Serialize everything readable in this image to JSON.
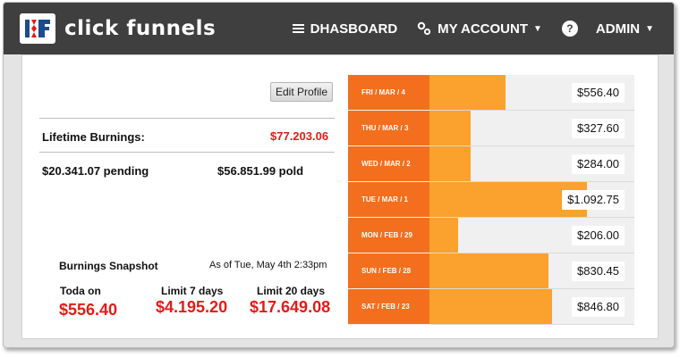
{
  "header": {
    "logo_text": "click funnels",
    "nav": {
      "dashboard": "DHASBOARD",
      "my_account": "MY ACCOUNT",
      "help": "?",
      "admin": "ADMIN"
    },
    "icons": [
      "menu-icon",
      "gear-icon",
      "help-icon",
      "caret-down-icon"
    ]
  },
  "profile": {
    "edit_label": "Edit Profile",
    "lifetime_label": "Lifetime Burnings:",
    "lifetime_value": "$77.203.06",
    "pending": "$20.341.07 pending",
    "paid": "$56.851.99 pold"
  },
  "snapshot": {
    "title": "Burnings Snapshot",
    "as_of": "As of Tue, May 4th 2:33pm",
    "today_label": "Toda on",
    "today_value": "$556.40",
    "limit7_label": "Limit 7 days",
    "limit7_value": "$4.195.20",
    "limit20_label": "Limit 20 days",
    "limit20_value": "$17.649.08"
  },
  "daily": [
    {
      "day": "FRI / MAR / 4",
      "amount": "$556.40",
      "level": 0.37
    },
    {
      "day": "THU / MAR / 3",
      "amount": "$327.60",
      "level": 0.2
    },
    {
      "day": "WED / MAR / 2",
      "amount": "$284.00",
      "level": 0.2
    },
    {
      "day": "TUE / MAR / 1",
      "amount": "$1.092.75",
      "level": 0.77
    },
    {
      "day": "MON / FEB / 29",
      "amount": "$206.00",
      "level": 0.14
    },
    {
      "day": "SUN / FEB / 28",
      "amount": "$830.45",
      "level": 0.58
    },
    {
      "day": "SAT / FEB / 23",
      "amount": "$846.80",
      "level": 0.6
    }
  ],
  "colors": {
    "topbar": "#3f3f3f",
    "day_label_bg": "#f36f1d",
    "bar": "#fba12d",
    "money_red": "#e41b17"
  }
}
